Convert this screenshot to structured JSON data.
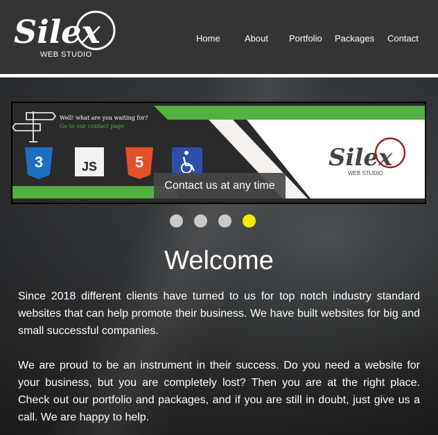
{
  "brand": {
    "name": "Silex",
    "subtitle": "WEB STUDIO"
  },
  "nav": {
    "items": [
      "Home",
      "About",
      "Portfolio",
      "Packages",
      "Contact"
    ]
  },
  "slider": {
    "sign_line1": "Well! what are you waiting for?",
    "sign_line2": "Go to our contact page",
    "badges": [
      "CSS3",
      "JS",
      "HTML5",
      "Accessibility"
    ],
    "caption": "Contact us at any time",
    "slide_count": 4,
    "active_slide": 4
  },
  "main": {
    "heading": "Welcome",
    "paragraphs": [
      "Since 2018 different clients have turned to us for top notch industry standard websites that can help promote their business. We have built websites for big and small successful companies.",
      "We are proud to be an instrument in their success. Do you need a website for your business, but you are completely lost? Then you are at the right place. Check out our portfolio and packages, and if you are still in doubt, just give us a call. We are happy to help."
    ]
  },
  "colors": {
    "accent_green": "#55b043",
    "brand_red": "#a01f1f",
    "active_dot": "#f2ee00",
    "css3_blue": "#1e6fc0",
    "html5_orange": "#e34f26",
    "a11y_blue": "#2e4fa8"
  }
}
